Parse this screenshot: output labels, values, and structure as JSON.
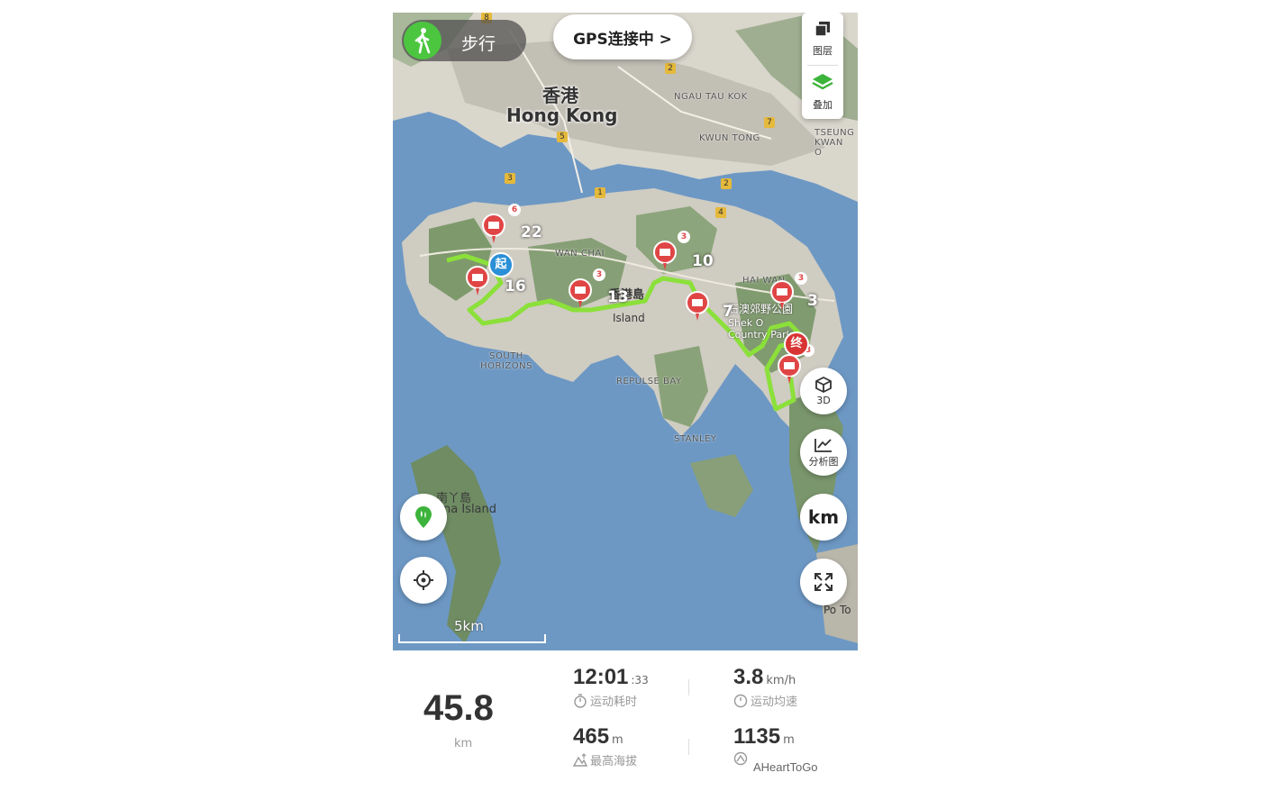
{
  "mode": {
    "label": "步行",
    "icon": "walking-icon"
  },
  "gps": {
    "label": "GPS连接中 >"
  },
  "layer_panel": {
    "layers_label": "图层",
    "overlay_label": "叠加"
  },
  "buttons": {
    "threed_label": "3D",
    "analysis_label": "分析图",
    "unit_label": "km"
  },
  "map": {
    "labels": {
      "hk_cn": "香港",
      "hk_en": "Hong Kong",
      "ngau_tau_kok": "NGAU TAU KOK",
      "kwun_tong": "KWUN TONG",
      "tseung_kwan_o": "TSEUNG KWAN O",
      "wan_chai": "WAN CHAI",
      "south_horizons": "SOUTH HORIZONS",
      "repulse_bay": "REPULSE BAY",
      "stanley": "STANLEY",
      "hk_island_cn": "香港島",
      "hk_island_en": "Island",
      "lamma_cn": "南丫島",
      "lamma_en": "na Island",
      "shek_o_cn": "石澳郊野公園",
      "shek_o_en": "Shek O Country Park",
      "po_toi": "Po To",
      "chai_wan": "HAI WAN"
    },
    "start_label": "起",
    "end_label": "终",
    "waypoint_counts": [
      "22",
      "16",
      "13",
      "10",
      "7",
      "3"
    ],
    "photo_badges": [
      "6",
      "3",
      "3",
      "3",
      "3"
    ],
    "route_badges": [
      "8",
      "2",
      "7",
      "5",
      "3",
      "1",
      "2",
      "4"
    ],
    "scale_label": "5km"
  },
  "stats": {
    "distance_value": "45.8",
    "distance_unit": "km",
    "duration_value": "12:01",
    "duration_seconds": ":33",
    "duration_label": "运动耗时",
    "speed_value": "3.8",
    "speed_unit": "km/h",
    "speed_label": "运动均速",
    "altitude_value": "465",
    "altitude_unit": "m",
    "altitude_label": "最高海拔",
    "climb_value": "1135",
    "climb_unit": "m",
    "watermark": "AHeartToGo"
  },
  "colors": {
    "route": "#8be03a",
    "water": "#6d98c4",
    "marker": "#e04545",
    "start": "#2a8fd6",
    "accent": "#4cc63f"
  }
}
